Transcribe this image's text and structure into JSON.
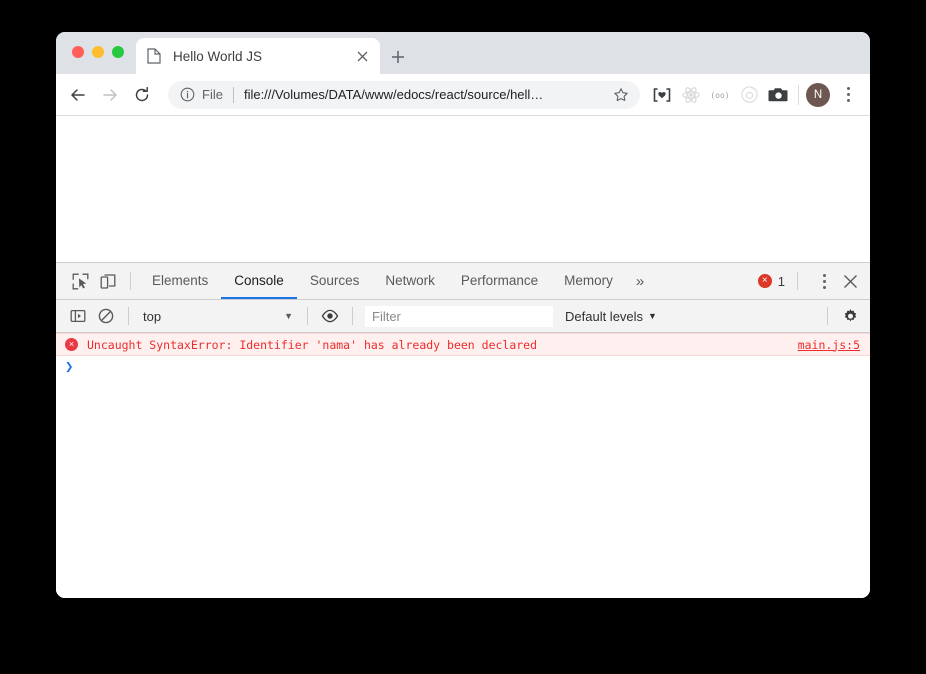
{
  "browser": {
    "window_controls": [
      {
        "name": "close",
        "color": "#ff5f57"
      },
      {
        "name": "minimize",
        "color": "#febc2e"
      },
      {
        "name": "maximize",
        "color": "#28c840"
      }
    ],
    "tab": {
      "title": "Hello World JS",
      "favicon": "page-icon",
      "close_label": "×"
    },
    "new_tab_label": "+",
    "nav": {
      "back": "back-arrow",
      "forward": "forward-arrow",
      "reload": "reload-arrow"
    },
    "omnibox": {
      "security_icon": "info-circle-icon",
      "scheme_label": "File",
      "url": "file:///Volumes/DATA/www/edocs/react/source/hell…",
      "bookmark_icon": "star-icon"
    },
    "extensions": [
      {
        "name": "bracket-heart-extension-icon",
        "glyph": "]♥["
      },
      {
        "name": "react-devtools-extension-icon",
        "glyph": "react"
      },
      {
        "name": "goggles-extension-icon",
        "glyph": "(oo)"
      },
      {
        "name": "circle-target-extension-icon",
        "glyph": "circle"
      },
      {
        "name": "camera-screenshot-extension-icon",
        "glyph": "camera"
      }
    ],
    "profile": {
      "initial": "N",
      "color": "#6d5750"
    },
    "menu_icon": "kebab-menu-icon"
  },
  "devtools": {
    "left_icons": [
      {
        "name": "inspect-element-icon"
      },
      {
        "name": "device-toolbar-icon"
      }
    ],
    "tabs": [
      {
        "label": "Elements",
        "active": false
      },
      {
        "label": "Console",
        "active": true
      },
      {
        "label": "Sources",
        "active": false
      },
      {
        "label": "Network",
        "active": false
      },
      {
        "label": "Performance",
        "active": false
      },
      {
        "label": "Memory",
        "active": false
      }
    ],
    "more_tabs_label": "»",
    "error_badge": {
      "icon": "×",
      "count": "1",
      "color": "#dc3626"
    },
    "settings_menu_icon": "kebab-menu-icon",
    "close_icon": "close-icon",
    "filterbar": {
      "sidebar_toggle_icon": "console-sidebar-icon",
      "clear_console_icon": "clear-console-icon",
      "context_value": "top",
      "context_caret": "▼",
      "live_expression_icon": "eye-icon",
      "filter_placeholder": "Filter",
      "filter_value": "",
      "levels_label": "Default levels",
      "levels_caret": "▼",
      "settings_icon": "gear-icon"
    },
    "console": {
      "error": {
        "icon": "×",
        "message": "Uncaught SyntaxError: Identifier 'nama' has already been declared",
        "source": "main.js:5",
        "text_color": "#ee2b2b",
        "background": "#fff0f0"
      },
      "prompt_caret": "❯",
      "prompt_value": ""
    }
  }
}
